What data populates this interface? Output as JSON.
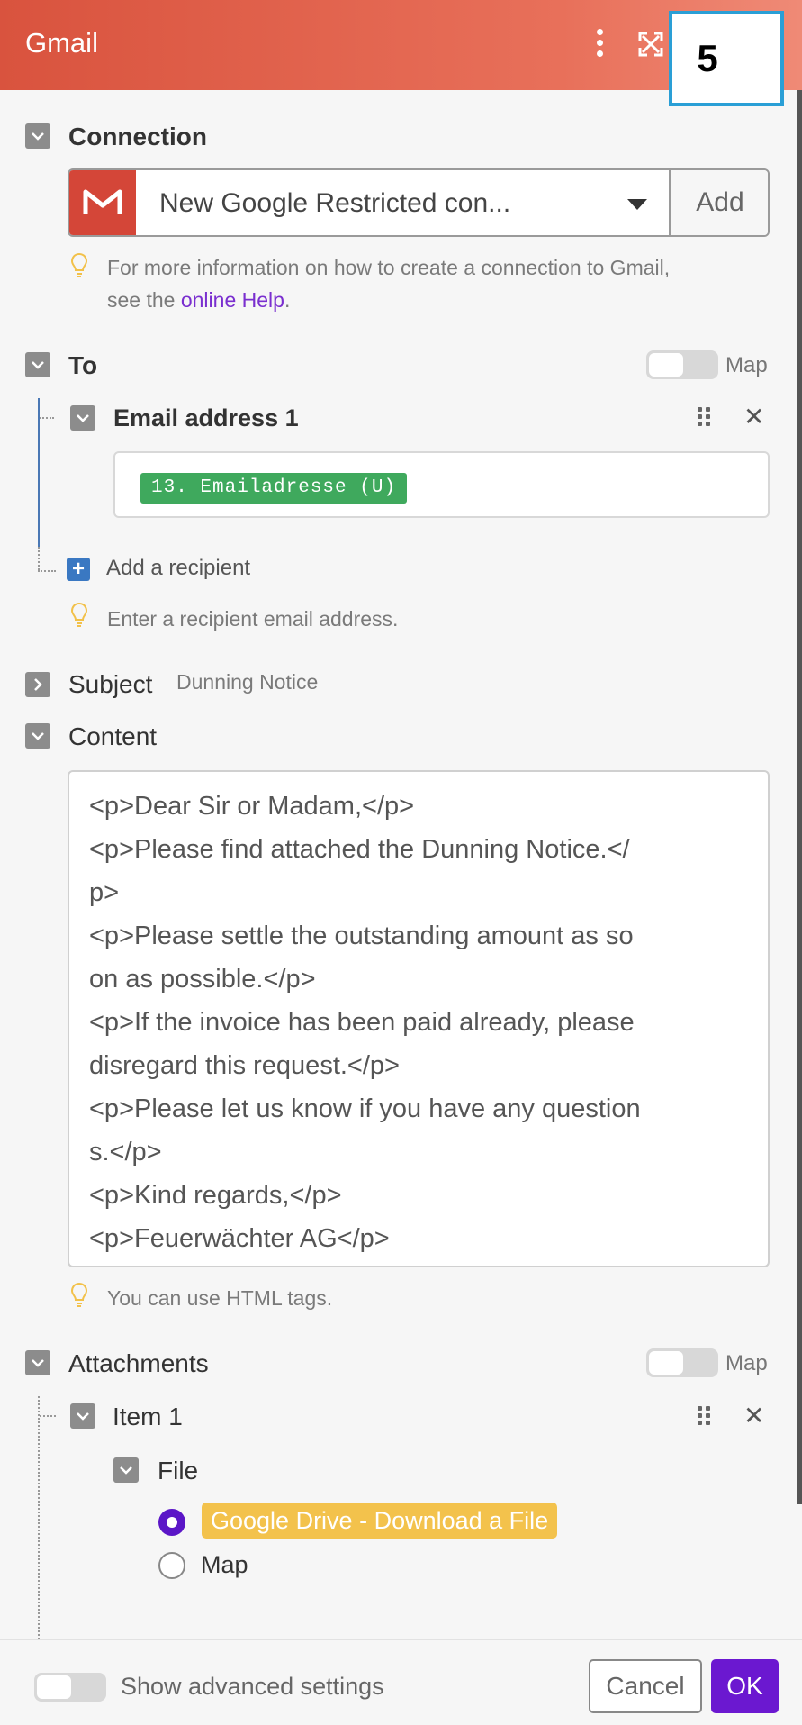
{
  "header": {
    "title": "Gmail",
    "step_number": "5"
  },
  "connection": {
    "label": "Connection",
    "selected": "New Google Restricted con...",
    "add_label": "Add",
    "hint_prefix": "For more information on how to create a connection to Gmail,",
    "hint_line2_prefix": "see the ",
    "hint_link": "online Help",
    "hint_suffix": "."
  },
  "to": {
    "label": "To",
    "map_label": "Map",
    "email_item_label": "Email address 1",
    "email_value": "13. Emailadresse (U)",
    "add_recipient_label": "Add a recipient",
    "hint": "Enter a recipient email address."
  },
  "subject": {
    "label": "Subject",
    "value": "Dunning Notice"
  },
  "content": {
    "label": "Content",
    "lines": [
      "<p>Dear Sir or Madam,</p>",
      "<p>Please find attached the Dunning Notice.</",
      "p>",
      "<p>Please settle the outstanding amount as so",
      "on as possible.</p>",
      "<p>If the invoice has been paid already, please",
      "disregard this request.</p>",
      "<p>Please let us know if you have any question",
      "s.</p>",
      "<p>Kind regards,</p>",
      "<p>Feuerwächter AG</p>"
    ],
    "hint": "You can use HTML tags."
  },
  "attachments": {
    "label": "Attachments",
    "map_label": "Map",
    "item_label": "Item 1",
    "file_label": "File",
    "option_selected": "Google Drive - Download a File",
    "option_map": "Map"
  },
  "footer": {
    "advanced_label": "Show advanced settings",
    "cancel_label": "Cancel",
    "ok_label": "OK"
  },
  "colors": {
    "header_start": "#d9533e",
    "accent_purple": "#6b18d0",
    "pill_green": "#3fa95d",
    "pill_yellow": "#f3c24c",
    "link_purple": "#7a2fcf"
  }
}
